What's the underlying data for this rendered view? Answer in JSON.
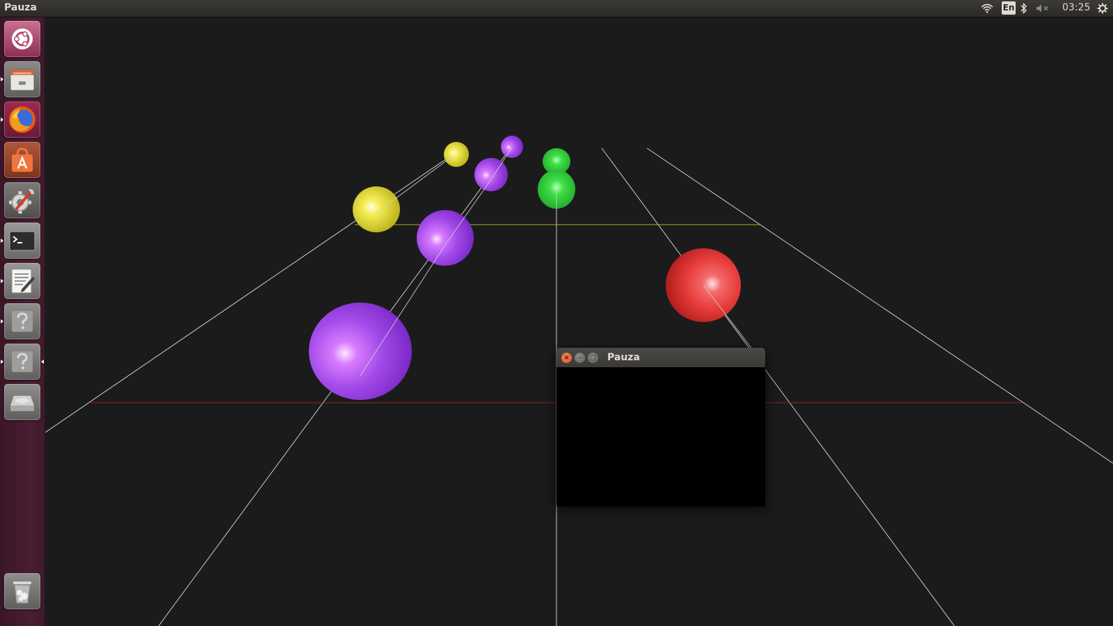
{
  "top_panel": {
    "app_title": "Pauza",
    "keyboard_layout": "En",
    "clock": "03:25",
    "icons": [
      "wifi-icon",
      "bluetooth-icon",
      "volume-muted-icon",
      "session-gear-icon"
    ]
  },
  "launcher": {
    "items": [
      {
        "name": "ubuntu-dash-icon",
        "running": false
      },
      {
        "name": "files-icon",
        "running": true
      },
      {
        "name": "firefox-icon",
        "running": true
      },
      {
        "name": "software-center-icon",
        "running": false
      },
      {
        "name": "system-settings-icon",
        "running": false
      },
      {
        "name": "terminal-icon",
        "running": true
      },
      {
        "name": "text-editor-icon",
        "running": true
      },
      {
        "name": "unknown-app-icon",
        "running": true
      },
      {
        "name": "unknown-app-icon",
        "running": true,
        "focused": true
      },
      {
        "name": "disk-drive-icon",
        "running": false
      },
      {
        "name": "trash-icon",
        "running": false
      }
    ]
  },
  "dialog": {
    "title": "Pauza",
    "close_glyph": "×",
    "minimize_glyph": "–",
    "maximize_glyph": "□"
  },
  "scene": {
    "background": "#1b1b1b",
    "sphere_colors": {
      "yellow": "#e9e23a",
      "purple": "#9b3ee8",
      "green": "#2fd13a",
      "red": "#e63232"
    }
  }
}
